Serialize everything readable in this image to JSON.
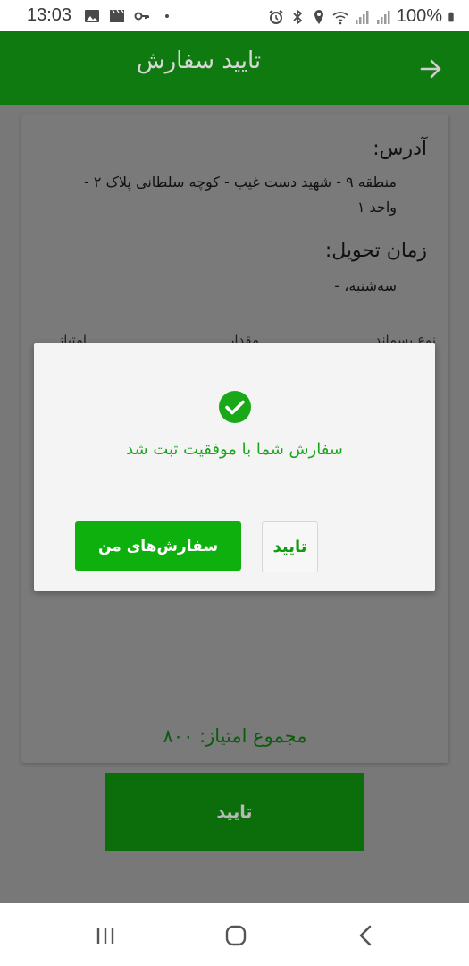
{
  "status_bar": {
    "time": "13:03",
    "battery": "100%",
    "icons_left": [
      "image-icon",
      "clapperboard-icon",
      "key-icon",
      "dot-icon"
    ],
    "icons_right": [
      "alarm-icon",
      "bluetooth-icon",
      "location-icon",
      "wifi-icon",
      "signal-icon",
      "signal-icon",
      "battery-icon"
    ]
  },
  "app_bar": {
    "title": "تایید سفارش",
    "back_icon": "arrow-right-icon"
  },
  "card": {
    "address_label": "آدرس:",
    "address_value": "منطقه ۹ - شهید دست غیب - کوچه سلطانی پلاک ۲ - واحد ۱",
    "delivery_label": "زمان تحویل:",
    "delivery_value": "سه‌شنبه، -",
    "table_headers": [
      "نوع پسماند",
      "مقدار",
      "امتیاز"
    ],
    "total": "مجموع امتیاز: ۸۰۰"
  },
  "confirm_button": "تایید",
  "dialog": {
    "icon": "check-circle-icon",
    "message": "سفارش شما با موفقیت ثبت شد",
    "my_orders_button": "سفارش‌های من",
    "ok_button": "تایید"
  },
  "nav_bar": {
    "recent_icon": "recent-apps-icon",
    "home_icon": "home-icon",
    "back_icon": "back-icon"
  },
  "colors": {
    "primary": "#0f7a0f",
    "accent": "#0db00d",
    "success": "#1aa51a"
  }
}
